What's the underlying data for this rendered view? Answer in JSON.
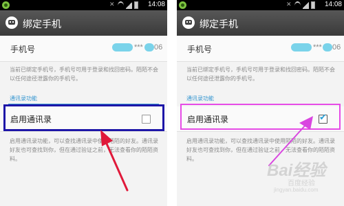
{
  "screens": [
    {
      "status_time": "14:08",
      "title": "绑定手机",
      "phone_label": "手机号",
      "masked_phone": "***",
      "phone_suffix": "06",
      "description_1": "当前已绑定手机号，手机号可用于登录和找回密码。陌陌不会以任何途径泄露你的手机号。",
      "section_heading": "通讯录功能",
      "contacts_label": "启用通讯录",
      "contacts_enabled": false,
      "description_2": "启用通讯录功能，可以查找通讯录中使用陌陌的好友。通讯录好友也可查找到你，但在通过验证之前，无法查看你的陌陌资料。"
    },
    {
      "status_time": "14:08",
      "title": "绑定手机",
      "phone_label": "手机号",
      "masked_phone": "***",
      "phone_suffix": "06",
      "description_1": "当前已绑定手机号，手机号可用于登录和找回密码。陌陌不会以任何途径泄露你的手机号。",
      "section_heading": "通讯录功能",
      "contacts_label": "启用通讯录",
      "contacts_enabled": true,
      "description_2": "启用通讯录功能，可以查找通讯录中使用陌陌的好友。通讯录好友也可查找到你，但在通过验证之前，无法查看你的陌陌资料。"
    }
  ],
  "watermark": {
    "brand": "Bai经验",
    "sub": "百度经验",
    "url": "jingyan.baidu.com"
  },
  "colors": {
    "accent": "#3596d0",
    "highlight_left": "#1d16a8",
    "highlight_right": "#e64be6",
    "arrow_left": "#e0193a",
    "arrow_right": "#d946e0",
    "blur_mask": "#7ad3ea"
  }
}
